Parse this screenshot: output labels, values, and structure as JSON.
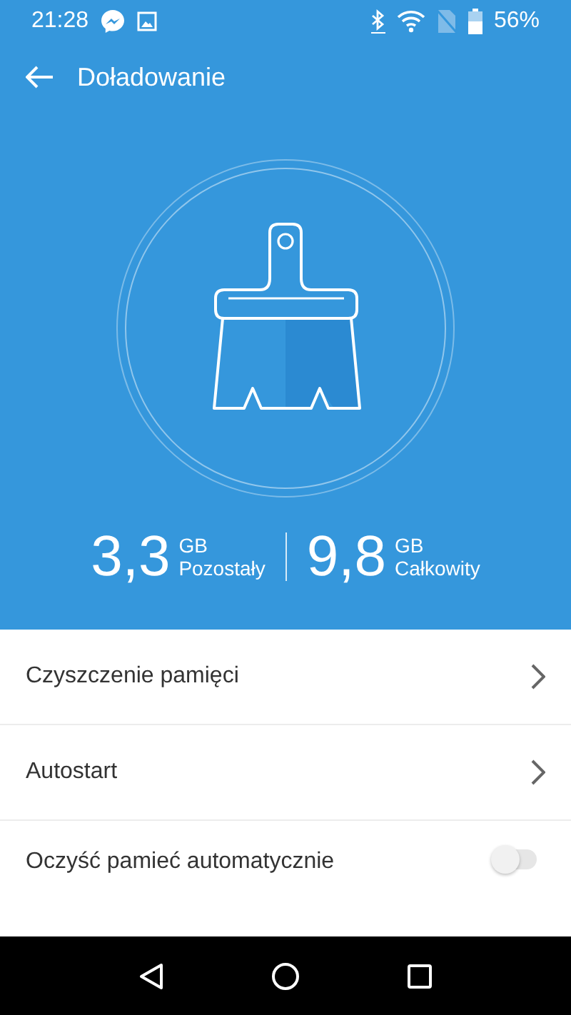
{
  "status_bar": {
    "time": "21:28",
    "battery": "56%"
  },
  "header": {
    "title": "Doładowanie"
  },
  "storage": [
    {
      "value": "3,3",
      "unit": "GB",
      "label": "Pozostały"
    },
    {
      "value": "9,8",
      "unit": "GB",
      "label": "Całkowity"
    }
  ],
  "settings": [
    {
      "kind": "link",
      "label": "Czyszczenie pamięci"
    },
    {
      "kind": "link",
      "label": "Autostart"
    },
    {
      "kind": "toggle",
      "label": "Oczyść pamieć automatycznie",
      "on": false
    }
  ]
}
